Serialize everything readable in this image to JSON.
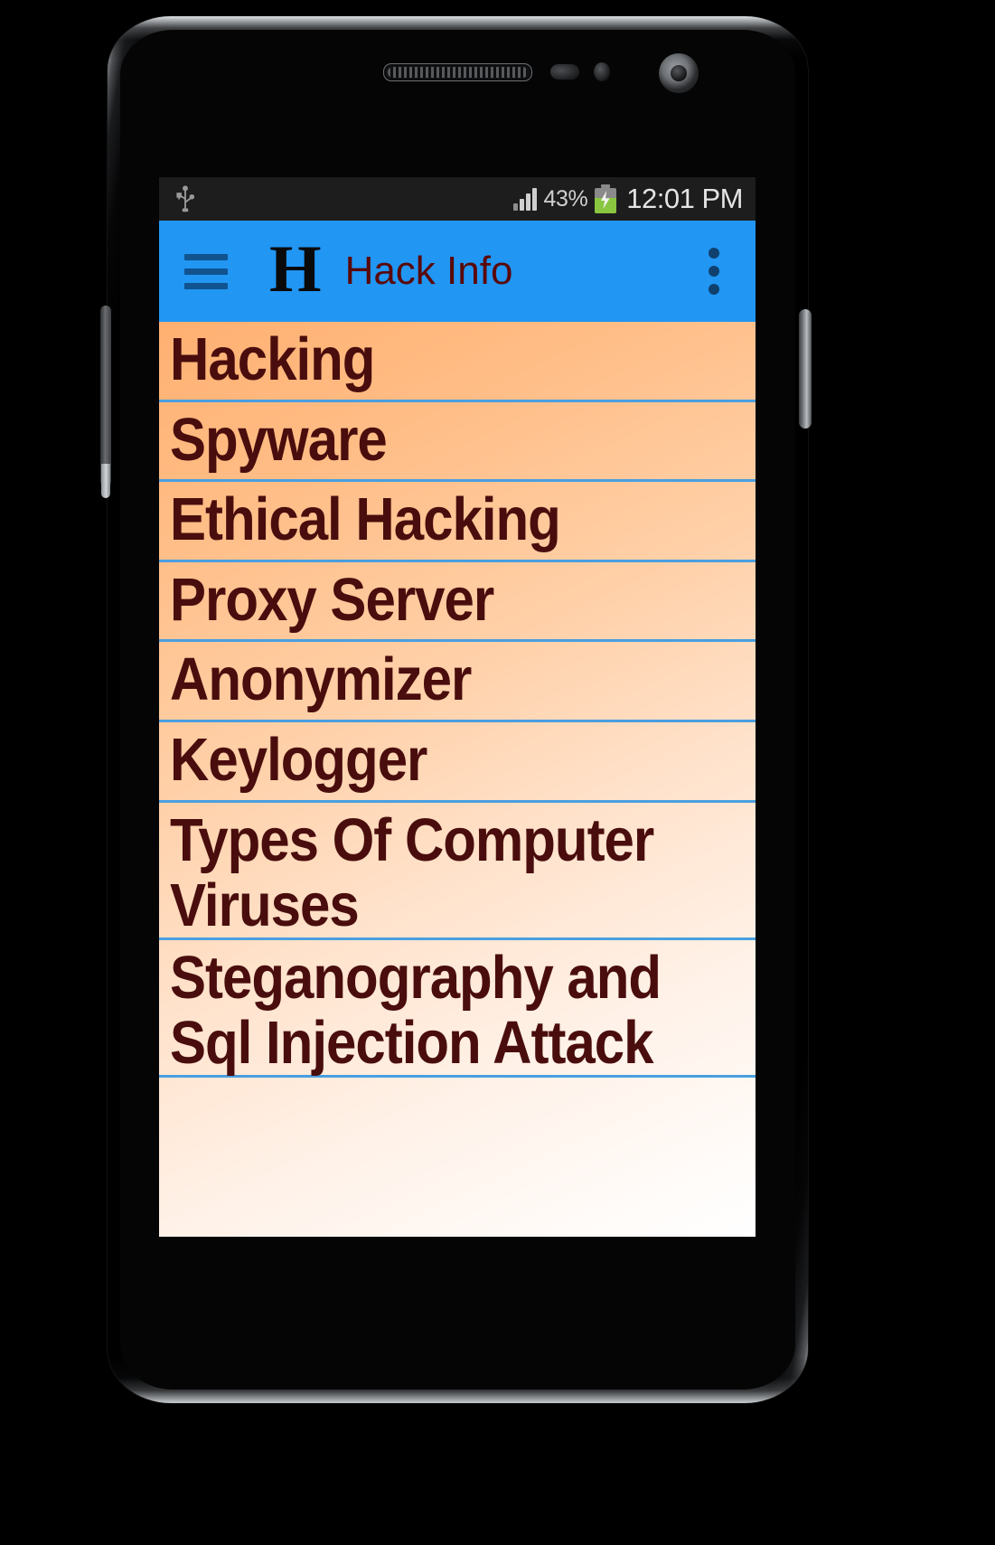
{
  "device": {
    "name": "android-phone-mockup",
    "background_color": "#000000"
  },
  "status_bar": {
    "background_color": "#1d1d1d",
    "usb_icon": "usb-icon",
    "signal_icon": "signal-bars-icon",
    "battery_percent": "43%",
    "battery_icon": "battery-charging-icon",
    "time": "12:01",
    "ampm": " PM"
  },
  "app_bar": {
    "background_color": "#2196f3",
    "menu_icon": "hamburger-menu-icon",
    "logo_letter": "H",
    "title": "Hack Info",
    "title_color": "#5a0808",
    "overflow_icon": "overflow-menu-icon"
  },
  "list": {
    "divider_color": "#4a9fe0",
    "text_color": "#4a0d0d",
    "gradient_from": "#ffb071",
    "gradient_to": "#ffffff",
    "items": [
      {
        "label": "Hacking"
      },
      {
        "label": "Spyware"
      },
      {
        "label": "Ethical Hacking"
      },
      {
        "label": "Proxy Server"
      },
      {
        "label": "Anonymizer"
      },
      {
        "label": "Keylogger"
      },
      {
        "label": "Types Of Computer Viruses"
      },
      {
        "label": "Steganography and Sql Injection Attack"
      }
    ]
  }
}
